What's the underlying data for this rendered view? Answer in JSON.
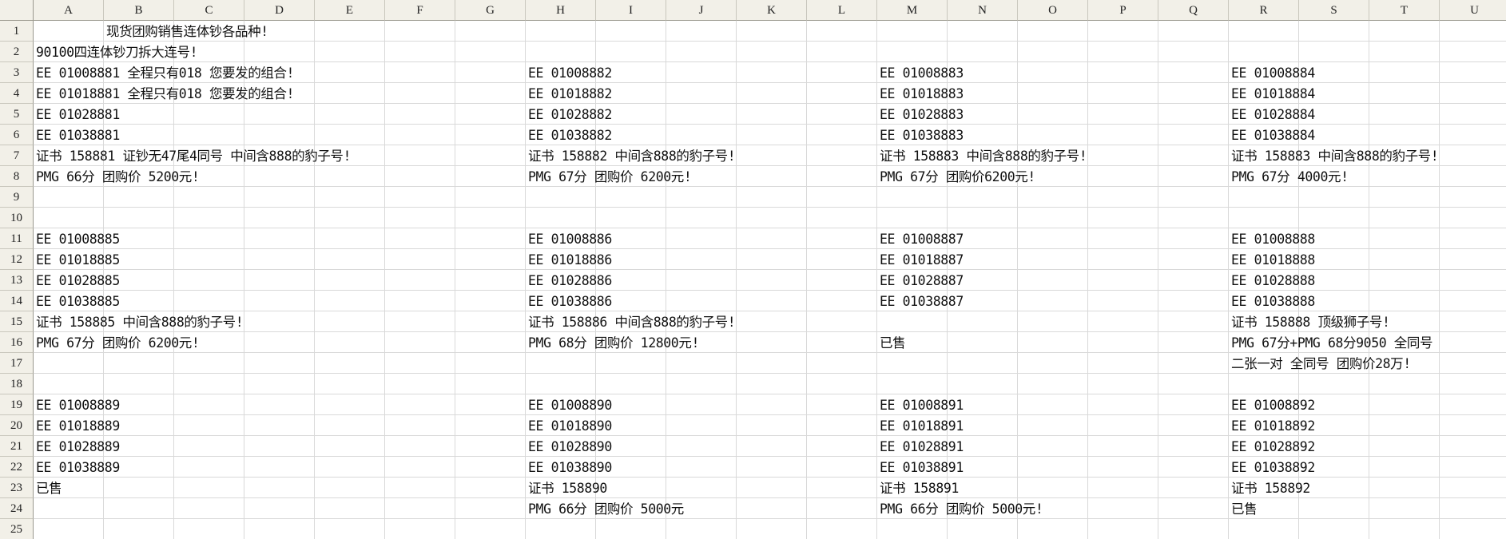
{
  "columns": [
    "A",
    "B",
    "C",
    "D",
    "E",
    "F",
    "G",
    "H",
    "I",
    "J",
    "K",
    "L",
    "M",
    "N",
    "O",
    "P",
    "Q",
    "R",
    "S",
    "T",
    "U"
  ],
  "rows": [
    "1",
    "2",
    "3",
    "4",
    "5",
    "6",
    "7",
    "8",
    "9",
    "10",
    "11",
    "12",
    "13",
    "14",
    "15",
    "16",
    "17",
    "18",
    "19",
    "20",
    "21",
    "22",
    "23",
    "24",
    "25"
  ],
  "cells": [
    {
      "ref": "B1",
      "text": "现货团购销售连体钞各品种!"
    },
    {
      "ref": "A2",
      "text": "90100四连体钞刀拆大连号!"
    },
    {
      "ref": "A3",
      "text": "EE 01008881 全程只有018 您要发的组合!"
    },
    {
      "ref": "H3",
      "text": "EE 01008882"
    },
    {
      "ref": "M3",
      "text": "EE 01008883"
    },
    {
      "ref": "R3",
      "text": "EE 01008884"
    },
    {
      "ref": "A4",
      "text": "EE 01018881 全程只有018 您要发的组合!"
    },
    {
      "ref": "H4",
      "text": "EE 01018882"
    },
    {
      "ref": "M4",
      "text": "EE 01018883"
    },
    {
      "ref": "R4",
      "text": "EE 01018884"
    },
    {
      "ref": "A5",
      "text": "EE 01028881"
    },
    {
      "ref": "H5",
      "text": "EE 01028882"
    },
    {
      "ref": "M5",
      "text": "EE 01028883"
    },
    {
      "ref": "R5",
      "text": "EE 01028884"
    },
    {
      "ref": "A6",
      "text": "EE 01038881"
    },
    {
      "ref": "H6",
      "text": "EE 01038882"
    },
    {
      "ref": "M6",
      "text": "EE 01038883"
    },
    {
      "ref": "R6",
      "text": "EE 01038884"
    },
    {
      "ref": "A7",
      "text": "证书 158881 证钞无47尾4同号  中间含888的豹子号!"
    },
    {
      "ref": "H7",
      "text": "证书 158882  中间含888的豹子号!"
    },
    {
      "ref": "M7",
      "text": "证书 158883  中间含888的豹子号!"
    },
    {
      "ref": "R7",
      "text": "证书 158883  中间含888的豹子号!"
    },
    {
      "ref": "A8",
      "text": "PMG 66分 团购价 5200元!"
    },
    {
      "ref": "H8",
      "text": "PMG 67分 团购价 6200元!"
    },
    {
      "ref": "M8",
      "text": "PMG 67分 团购价6200元!"
    },
    {
      "ref": "R8",
      "text": "PMG 67分 4000元!"
    },
    {
      "ref": "A11",
      "text": "EE 01008885"
    },
    {
      "ref": "H11",
      "text": "EE 01008886"
    },
    {
      "ref": "M11",
      "text": "EE 01008887"
    },
    {
      "ref": "R11",
      "text": "EE 01008888"
    },
    {
      "ref": "A12",
      "text": "EE 01018885"
    },
    {
      "ref": "H12",
      "text": "EE 01018886"
    },
    {
      "ref": "M12",
      "text": "EE 01018887"
    },
    {
      "ref": "R12",
      "text": "EE 01018888"
    },
    {
      "ref": "A13",
      "text": "EE 01028885"
    },
    {
      "ref": "H13",
      "text": "EE 01028886"
    },
    {
      "ref": "M13",
      "text": "EE 01028887"
    },
    {
      "ref": "R13",
      "text": "EE 01028888"
    },
    {
      "ref": "A14",
      "text": "EE 01038885"
    },
    {
      "ref": "H14",
      "text": "EE 01038886"
    },
    {
      "ref": "M14",
      "text": "EE 01038887"
    },
    {
      "ref": "R14",
      "text": "EE 01038888"
    },
    {
      "ref": "A15",
      "text": "证书 158885  中间含888的豹子号!"
    },
    {
      "ref": "H15",
      "text": "证书 158886  中间含888的豹子号!"
    },
    {
      "ref": "R15",
      "text": "证书 158888 顶级狮子号!"
    },
    {
      "ref": "A16",
      "text": "PMG 67分 团购价 6200元!"
    },
    {
      "ref": "H16",
      "text": "PMG 68分 团购价 12800元!"
    },
    {
      "ref": "M16",
      "text": "已售"
    },
    {
      "ref": "R16",
      "text": "PMG 67分+PMG 68分9050 全同号"
    },
    {
      "ref": "R17",
      "text": "二张一对 全同号 团购价28万!"
    },
    {
      "ref": "A19",
      "text": "EE 01008889"
    },
    {
      "ref": "H19",
      "text": "EE 01008890"
    },
    {
      "ref": "M19",
      "text": "EE 01008891"
    },
    {
      "ref": "R19",
      "text": "EE 01008892"
    },
    {
      "ref": "A20",
      "text": "EE 01018889"
    },
    {
      "ref": "H20",
      "text": "EE 01018890"
    },
    {
      "ref": "M20",
      "text": "EE 01018891"
    },
    {
      "ref": "R20",
      "text": "EE 01018892"
    },
    {
      "ref": "A21",
      "text": "EE 01028889"
    },
    {
      "ref": "H21",
      "text": "EE 01028890"
    },
    {
      "ref": "M21",
      "text": "EE 01028891"
    },
    {
      "ref": "R21",
      "text": "EE 01028892"
    },
    {
      "ref": "A22",
      "text": "EE 01038889"
    },
    {
      "ref": "H22",
      "text": "EE 01038890"
    },
    {
      "ref": "M22",
      "text": "EE 01038891"
    },
    {
      "ref": "R22",
      "text": "EE 01038892"
    },
    {
      "ref": "A23",
      "text": "已售"
    },
    {
      "ref": "H23",
      "text": "证书 158890"
    },
    {
      "ref": "M23",
      "text": "证书 158891"
    },
    {
      "ref": "R23",
      "text": "证书 158892"
    },
    {
      "ref": "H24",
      "text": "PMG 66分 团购价 5000元"
    },
    {
      "ref": "M24",
      "text": "PMG 66分 团购价 5000元!"
    },
    {
      "ref": "R24",
      "text": "已售"
    }
  ]
}
